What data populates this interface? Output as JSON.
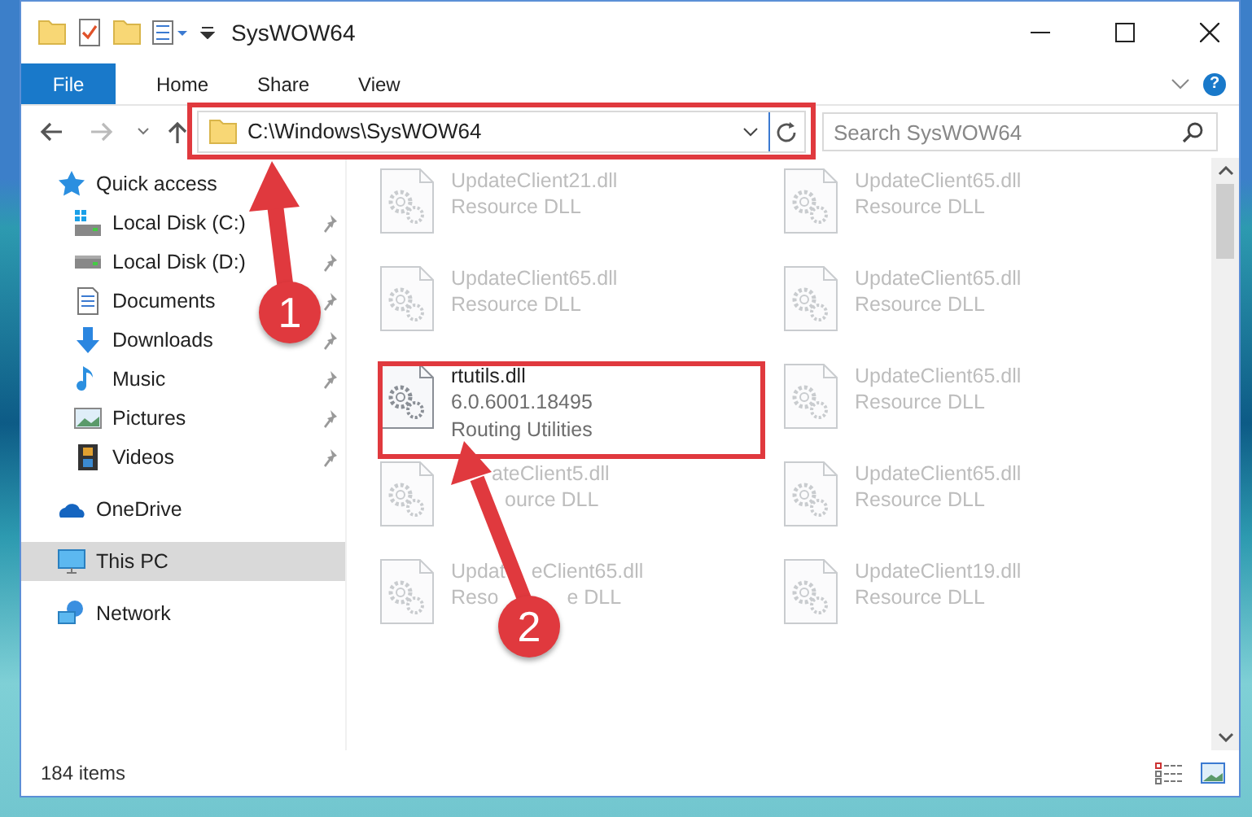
{
  "window": {
    "title": "SysWOW64"
  },
  "ribbon": {
    "file_tab": "File",
    "tabs": [
      {
        "label": "Home",
        "selected": false
      },
      {
        "label": "Share",
        "selected": false
      },
      {
        "label": "View",
        "selected": false
      }
    ],
    "help": "?"
  },
  "address": {
    "path": "C:\\Windows\\SysWOW64"
  },
  "search": {
    "placeholder": "Search SysWOW64"
  },
  "sidebar": {
    "items": [
      {
        "label": "Quick access",
        "kind": "star",
        "selected": false,
        "children": [
          {
            "label": "Local Disk (C:)",
            "kind": "system-drive",
            "pinned": true,
            "selected": false
          },
          {
            "label": "Local Disk (D:)",
            "kind": "drive",
            "pinned": true,
            "selected": false
          },
          {
            "label": "Documents",
            "kind": "document",
            "pinned": true,
            "selected": false
          },
          {
            "label": "Downloads",
            "kind": "download",
            "pinned": true,
            "selected": false
          },
          {
            "label": "Music",
            "kind": "music",
            "pinned": true,
            "selected": false
          },
          {
            "label": "Pictures",
            "kind": "pictures",
            "pinned": true,
            "selected": false
          },
          {
            "label": "Videos",
            "kind": "videos",
            "pinned": true,
            "selected": false
          }
        ]
      },
      {
        "label": "OneDrive",
        "kind": "cloud",
        "selected": false
      },
      {
        "label": "This PC",
        "kind": "pc",
        "selected": true
      },
      {
        "label": "Network",
        "kind": "network",
        "selected": false
      }
    ]
  },
  "files": [
    {
      "name": [
        "UpdateClient21.dll"
      ],
      "details": [
        [
          "Resource DLL"
        ]
      ],
      "faded": true
    },
    {
      "name": [
        "UpdateClient65.dll"
      ],
      "details": [
        [
          "Resource DLL"
        ]
      ],
      "faded": true
    },
    {
      "name": [
        "UpdateClient65.dll"
      ],
      "details": [
        [
          "Resource DLL"
        ]
      ],
      "faded": true
    },
    {
      "name": [
        "UpdateClient65.dll"
      ],
      "details": [
        [
          "Resource DLL"
        ]
      ],
      "faded": true
    },
    {
      "name": [
        "rtutils.dll"
      ],
      "details": [
        [
          "6.0.6001.18495"
        ],
        [
          "Routing Utilities"
        ]
      ],
      "faded": false
    },
    {
      "name": [
        "UpdateClient65.dll"
      ],
      "details": [
        [
          "Resource DLL"
        ]
      ],
      "faded": true
    },
    {
      "name": [
        "ateClient5.dll"
      ],
      "details": [
        [
          "ource DLL"
        ]
      ],
      "faded": true
    },
    {
      "name": [
        "UpdateClient65.dll"
      ],
      "details": [
        [
          "Resource DLL"
        ]
      ],
      "faded": true
    },
    {
      "name": [
        "Updat",
        "eClient65.dll"
      ],
      "details": [
        [
          "Reso",
          "e DLL"
        ]
      ],
      "faded": true
    },
    {
      "name": [
        "UpdateClient19.dll"
      ],
      "details": [
        [
          "Resource DLL"
        ]
      ],
      "faded": true
    }
  ],
  "status_bar": {
    "count": "184 items"
  },
  "annotations": [
    {
      "number": "1"
    },
    {
      "number": "2"
    }
  ]
}
